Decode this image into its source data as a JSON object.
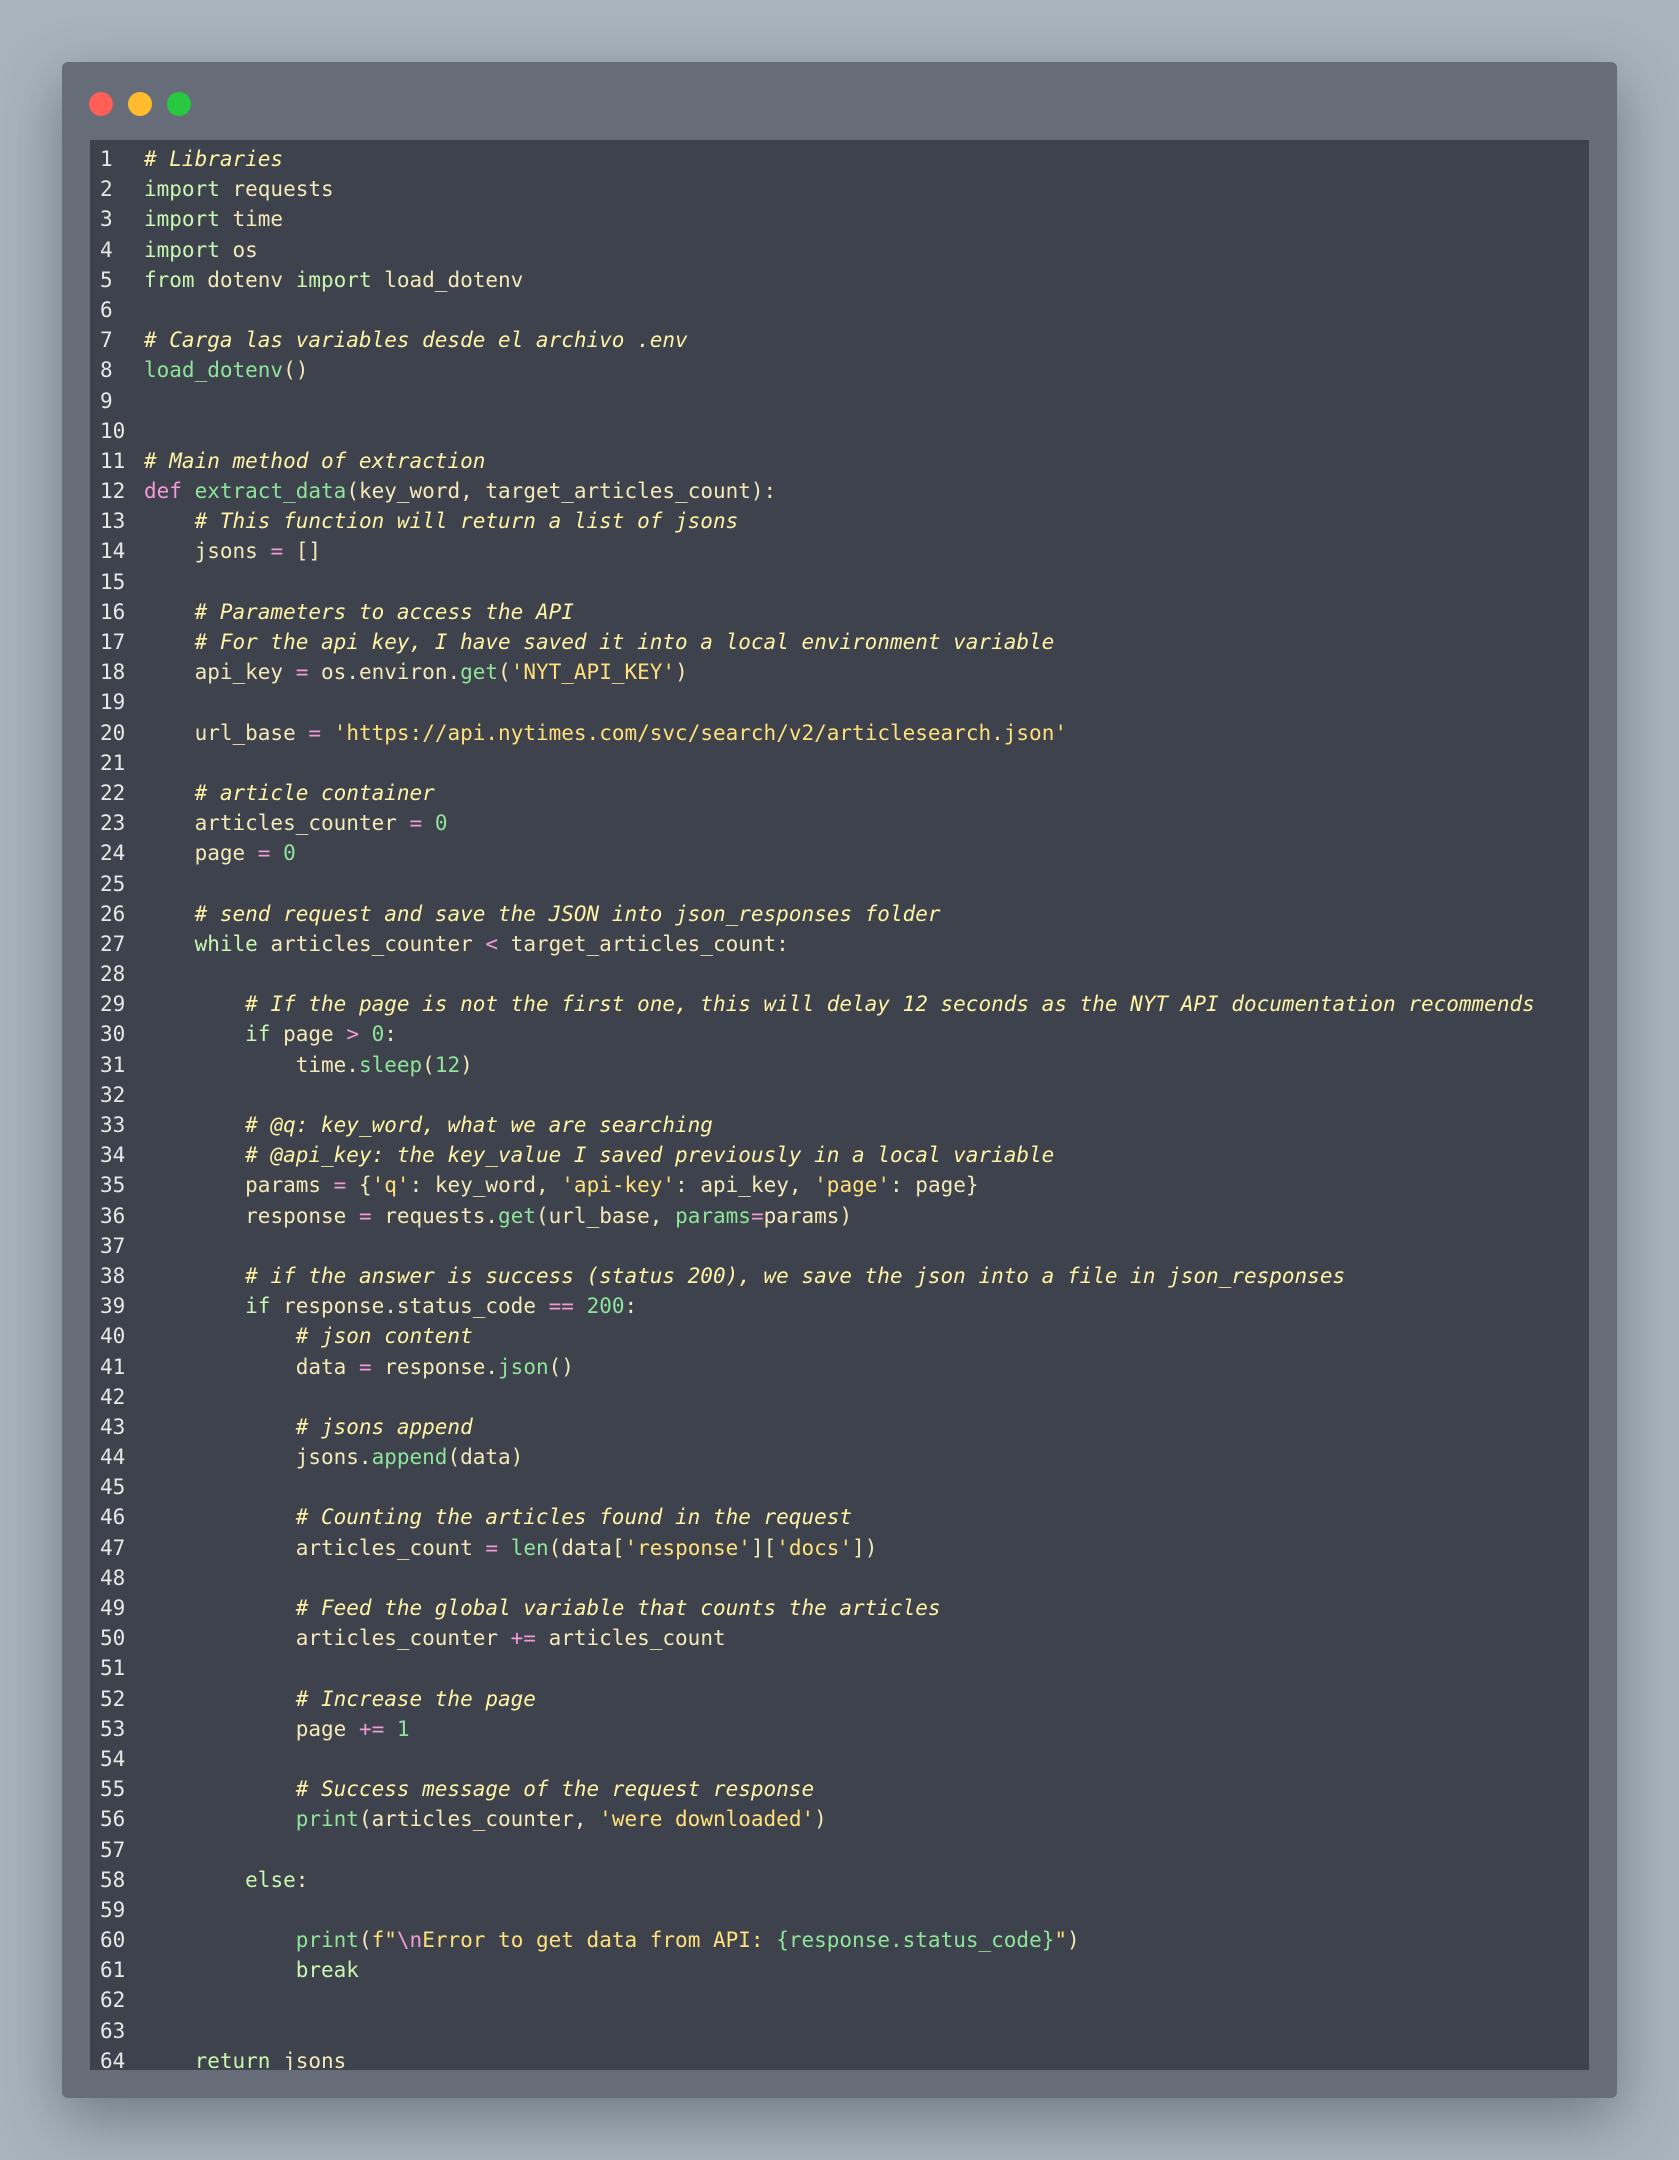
{
  "window": {
    "controls": [
      {
        "name": "close-button",
        "color": "#fe5f57"
      },
      {
        "name": "minimize-button",
        "color": "#febc2e"
      },
      {
        "name": "maximize-button",
        "color": "#28c840"
      }
    ]
  },
  "editor": {
    "language": "python",
    "colors": {
      "background": "#3d424c",
      "frame": "#666d79",
      "comment": "#fff3a6",
      "keyword": "#c8f7b0",
      "def": "#f39ad8",
      "function": "#8ee59a",
      "string": "#ffe07a",
      "number": "#8ee59a",
      "operator": "#f39ad8",
      "text": "#f4e9b8"
    },
    "lines": [
      {
        "n": "1",
        "indent": 0,
        "tokens": [
          [
            "comment",
            "# Libraries"
          ]
        ]
      },
      {
        "n": "2",
        "indent": 0,
        "tokens": [
          [
            "keyword",
            "import"
          ],
          [
            "plain",
            " requests"
          ]
        ]
      },
      {
        "n": "3",
        "indent": 0,
        "tokens": [
          [
            "keyword",
            "import"
          ],
          [
            "plain",
            " time"
          ]
        ]
      },
      {
        "n": "4",
        "indent": 0,
        "tokens": [
          [
            "keyword",
            "import"
          ],
          [
            "plain",
            " os"
          ]
        ]
      },
      {
        "n": "5",
        "indent": 0,
        "tokens": [
          [
            "keyword",
            "from"
          ],
          [
            "plain",
            " dotenv "
          ],
          [
            "keyword",
            "import"
          ],
          [
            "plain",
            " load_dotenv"
          ]
        ]
      },
      {
        "n": "6",
        "indent": 0,
        "tokens": []
      },
      {
        "n": "7",
        "indent": 0,
        "tokens": [
          [
            "comment",
            "# Carga las variables desde el archivo .env"
          ]
        ]
      },
      {
        "n": "8",
        "indent": 0,
        "tokens": [
          [
            "func",
            "load_dotenv"
          ],
          [
            "punct",
            "()"
          ]
        ]
      },
      {
        "n": "9",
        "indent": 0,
        "tokens": []
      },
      {
        "n": "10",
        "indent": 0,
        "tokens": []
      },
      {
        "n": "11",
        "indent": 0,
        "tokens": [
          [
            "comment",
            "# Main method of extraction"
          ]
        ]
      },
      {
        "n": "12",
        "indent": 0,
        "tokens": [
          [
            "def",
            "def"
          ],
          [
            "plain",
            " "
          ],
          [
            "func",
            "extract_data"
          ],
          [
            "punct",
            "("
          ],
          [
            "plain",
            "key_word, target_articles_count"
          ],
          [
            "punct",
            "):"
          ]
        ]
      },
      {
        "n": "13",
        "indent": 1,
        "tokens": [
          [
            "comment",
            "# This function will return a list of jsons"
          ]
        ]
      },
      {
        "n": "14",
        "indent": 1,
        "tokens": [
          [
            "plain",
            "jsons "
          ],
          [
            "op",
            "="
          ],
          [
            "plain",
            " []"
          ]
        ]
      },
      {
        "n": "15",
        "indent": 0,
        "tokens": []
      },
      {
        "n": "16",
        "indent": 1,
        "tokens": [
          [
            "comment",
            "# Parameters to access the API"
          ]
        ]
      },
      {
        "n": "17",
        "indent": 1,
        "tokens": [
          [
            "comment",
            "# For the api key, I have saved it into a local environment variable"
          ]
        ]
      },
      {
        "n": "18",
        "indent": 1,
        "tokens": [
          [
            "plain",
            "api_key "
          ],
          [
            "op",
            "="
          ],
          [
            "plain",
            " os.environ."
          ],
          [
            "func",
            "get"
          ],
          [
            "punct",
            "("
          ],
          [
            "str",
            "'NYT_API_KEY'"
          ],
          [
            "punct",
            ")"
          ]
        ]
      },
      {
        "n": "19",
        "indent": 0,
        "tokens": []
      },
      {
        "n": "20",
        "indent": 1,
        "tokens": [
          [
            "plain",
            "url_base "
          ],
          [
            "op",
            "="
          ],
          [
            "plain",
            " "
          ],
          [
            "str",
            "'https://api.nytimes.com/svc/search/v2/articlesearch.json'"
          ]
        ]
      },
      {
        "n": "21",
        "indent": 0,
        "tokens": []
      },
      {
        "n": "22",
        "indent": 1,
        "tokens": [
          [
            "comment",
            "# article container"
          ]
        ]
      },
      {
        "n": "23",
        "indent": 1,
        "tokens": [
          [
            "plain",
            "articles_counter "
          ],
          [
            "op",
            "="
          ],
          [
            "plain",
            " "
          ],
          [
            "num",
            "0"
          ]
        ]
      },
      {
        "n": "24",
        "indent": 1,
        "tokens": [
          [
            "plain",
            "page "
          ],
          [
            "op",
            "="
          ],
          [
            "plain",
            " "
          ],
          [
            "num",
            "0"
          ]
        ]
      },
      {
        "n": "25",
        "indent": 0,
        "tokens": []
      },
      {
        "n": "26",
        "indent": 1,
        "tokens": [
          [
            "comment",
            "# send request and save the JSON into json_responses folder"
          ]
        ]
      },
      {
        "n": "27",
        "indent": 1,
        "tokens": [
          [
            "keyword",
            "while"
          ],
          [
            "plain",
            " articles_counter "
          ],
          [
            "op",
            "<"
          ],
          [
            "plain",
            " target_articles_count:"
          ]
        ]
      },
      {
        "n": "28",
        "indent": 0,
        "tokens": []
      },
      {
        "n": "29",
        "indent": 2,
        "tokens": [
          [
            "comment",
            "# If the page is not the first one, this will delay 12 seconds as the NYT API documentation recommends"
          ]
        ]
      },
      {
        "n": "30",
        "indent": 2,
        "tokens": [
          [
            "keyword",
            "if"
          ],
          [
            "plain",
            " page "
          ],
          [
            "op",
            ">"
          ],
          [
            "plain",
            " "
          ],
          [
            "num",
            "0"
          ],
          [
            "plain",
            ":"
          ]
        ]
      },
      {
        "n": "31",
        "indent": 3,
        "tokens": [
          [
            "plain",
            "time."
          ],
          [
            "func",
            "sleep"
          ],
          [
            "punct",
            "("
          ],
          [
            "num",
            "12"
          ],
          [
            "punct",
            ")"
          ]
        ]
      },
      {
        "n": "32",
        "indent": 0,
        "tokens": []
      },
      {
        "n": "33",
        "indent": 2,
        "tokens": [
          [
            "comment",
            "# @q: key_word, what we are searching"
          ]
        ]
      },
      {
        "n": "34",
        "indent": 2,
        "tokens": [
          [
            "comment",
            "# @api_key: the key_value I saved previously in a local variable"
          ]
        ]
      },
      {
        "n": "35",
        "indent": 2,
        "tokens": [
          [
            "plain",
            "params "
          ],
          [
            "op",
            "="
          ],
          [
            "plain",
            " {"
          ],
          [
            "str",
            "'q'"
          ],
          [
            "plain",
            ": key_word, "
          ],
          [
            "str",
            "'api-key'"
          ],
          [
            "plain",
            ": api_key, "
          ],
          [
            "str",
            "'page'"
          ],
          [
            "plain",
            ": page}"
          ]
        ]
      },
      {
        "n": "36",
        "indent": 2,
        "tokens": [
          [
            "plain",
            "response "
          ],
          [
            "op",
            "="
          ],
          [
            "plain",
            " requests."
          ],
          [
            "func",
            "get"
          ],
          [
            "punct",
            "("
          ],
          [
            "plain",
            "url_base, "
          ],
          [
            "func",
            "params"
          ],
          [
            "op",
            "="
          ],
          [
            "plain",
            "params"
          ],
          [
            "punct",
            ")"
          ]
        ]
      },
      {
        "n": "37",
        "indent": 0,
        "tokens": []
      },
      {
        "n": "38",
        "indent": 2,
        "tokens": [
          [
            "comment",
            "# if the answer is success (status 200), we save the json into a file in json_responses"
          ]
        ]
      },
      {
        "n": "39",
        "indent": 2,
        "tokens": [
          [
            "keyword",
            "if"
          ],
          [
            "plain",
            " response.status_code "
          ],
          [
            "op",
            "=="
          ],
          [
            "plain",
            " "
          ],
          [
            "num",
            "200"
          ],
          [
            "plain",
            ":"
          ]
        ]
      },
      {
        "n": "40",
        "indent": 3,
        "tokens": [
          [
            "comment",
            "# json content"
          ]
        ]
      },
      {
        "n": "41",
        "indent": 3,
        "tokens": [
          [
            "plain",
            "data "
          ],
          [
            "op",
            "="
          ],
          [
            "plain",
            " response."
          ],
          [
            "func",
            "json"
          ],
          [
            "punct",
            "()"
          ]
        ]
      },
      {
        "n": "42",
        "indent": 0,
        "tokens": []
      },
      {
        "n": "43",
        "indent": 3,
        "tokens": [
          [
            "comment",
            "# jsons append"
          ]
        ]
      },
      {
        "n": "44",
        "indent": 3,
        "tokens": [
          [
            "plain",
            "jsons."
          ],
          [
            "func",
            "append"
          ],
          [
            "punct",
            "("
          ],
          [
            "plain",
            "data"
          ],
          [
            "punct",
            ")"
          ]
        ]
      },
      {
        "n": "45",
        "indent": 0,
        "tokens": []
      },
      {
        "n": "46",
        "indent": 3,
        "tokens": [
          [
            "comment",
            "# Counting the articles found in the request"
          ]
        ]
      },
      {
        "n": "47",
        "indent": 3,
        "tokens": [
          [
            "plain",
            "articles_count "
          ],
          [
            "op",
            "="
          ],
          [
            "plain",
            " "
          ],
          [
            "func",
            "len"
          ],
          [
            "punct",
            "("
          ],
          [
            "plain",
            "data["
          ],
          [
            "str",
            "'response'"
          ],
          [
            "plain",
            "]["
          ],
          [
            "str",
            "'docs'"
          ],
          [
            "plain",
            "]"
          ],
          [
            "punct",
            ")"
          ]
        ]
      },
      {
        "n": "48",
        "indent": 0,
        "tokens": []
      },
      {
        "n": "49",
        "indent": 3,
        "tokens": [
          [
            "comment",
            "# Feed the global variable that counts the articles"
          ]
        ]
      },
      {
        "n": "50",
        "indent": 3,
        "tokens": [
          [
            "plain",
            "articles_counter "
          ],
          [
            "op",
            "+="
          ],
          [
            "plain",
            " articles_count"
          ]
        ]
      },
      {
        "n": "51",
        "indent": 0,
        "tokens": []
      },
      {
        "n": "52",
        "indent": 3,
        "tokens": [
          [
            "comment",
            "# Increase the page"
          ]
        ]
      },
      {
        "n": "53",
        "indent": 3,
        "tokens": [
          [
            "plain",
            "page "
          ],
          [
            "op",
            "+="
          ],
          [
            "plain",
            " "
          ],
          [
            "num",
            "1"
          ]
        ]
      },
      {
        "n": "54",
        "indent": 0,
        "tokens": []
      },
      {
        "n": "55",
        "indent": 3,
        "tokens": [
          [
            "comment",
            "# Success message of the request response"
          ]
        ]
      },
      {
        "n": "56",
        "indent": 3,
        "tokens": [
          [
            "func",
            "print"
          ],
          [
            "punct",
            "("
          ],
          [
            "plain",
            "articles_counter, "
          ],
          [
            "str",
            "'were downloaded'"
          ],
          [
            "punct",
            ")"
          ]
        ]
      },
      {
        "n": "57",
        "indent": 0,
        "tokens": []
      },
      {
        "n": "58",
        "indent": 2,
        "tokens": [
          [
            "keyword",
            "else"
          ],
          [
            "plain",
            ":"
          ]
        ]
      },
      {
        "n": "59",
        "indent": 0,
        "tokens": []
      },
      {
        "n": "60",
        "indent": 3,
        "tokens": [
          [
            "func",
            "print"
          ],
          [
            "punct",
            "("
          ],
          [
            "str",
            "f\""
          ],
          [
            "esc",
            "\\n"
          ],
          [
            "str",
            "Error to get data from API: "
          ],
          [
            "interp",
            "{response.status_code}"
          ],
          [
            "str",
            "\""
          ],
          [
            "punct",
            ")"
          ]
        ]
      },
      {
        "n": "61",
        "indent": 3,
        "tokens": [
          [
            "keyword",
            "break"
          ]
        ]
      },
      {
        "n": "62",
        "indent": 0,
        "tokens": []
      },
      {
        "n": "63",
        "indent": 0,
        "tokens": []
      },
      {
        "n": "64",
        "indent": 1,
        "tokens": [
          [
            "keyword",
            "return"
          ],
          [
            "plain",
            " jsons"
          ]
        ]
      }
    ]
  }
}
